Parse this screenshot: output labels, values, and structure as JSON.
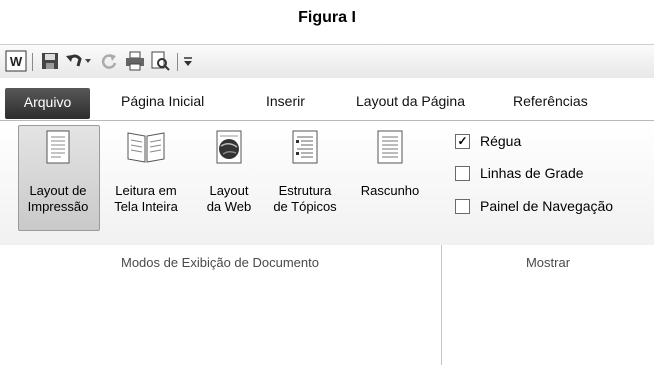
{
  "caption": "Figura I",
  "quick_access": {
    "icons": [
      "word-app-icon",
      "save-icon",
      "undo-icon",
      "undo-dropdown-icon",
      "redo-icon",
      "print-icon",
      "print-preview-icon",
      "customize-toolbar-icon"
    ]
  },
  "tabs": [
    {
      "label": "Arquivo"
    },
    {
      "label": "Página Inicial"
    },
    {
      "label": "Inserir"
    },
    {
      "label": "Layout da Página"
    },
    {
      "label": "Referências"
    }
  ],
  "view_group": {
    "label": "Modos de Exibição de Documento",
    "buttons": [
      {
        "line1": "Layout de",
        "line2": "Impressão"
      },
      {
        "line1": "Leitura em",
        "line2": "Tela Inteira"
      },
      {
        "line1": "Layout",
        "line2": "da Web"
      },
      {
        "line1": "Estrutura",
        "line2": "de Tópicos"
      },
      {
        "line1": "Rascunho",
        "line2": ""
      }
    ]
  },
  "show_group": {
    "label": "Mostrar",
    "options": [
      {
        "label": "Régua",
        "checked": true,
        "mark": "✓"
      },
      {
        "label": "Linhas de Grade",
        "checked": false
      },
      {
        "label": "Painel de Navegação",
        "checked": false
      }
    ]
  }
}
